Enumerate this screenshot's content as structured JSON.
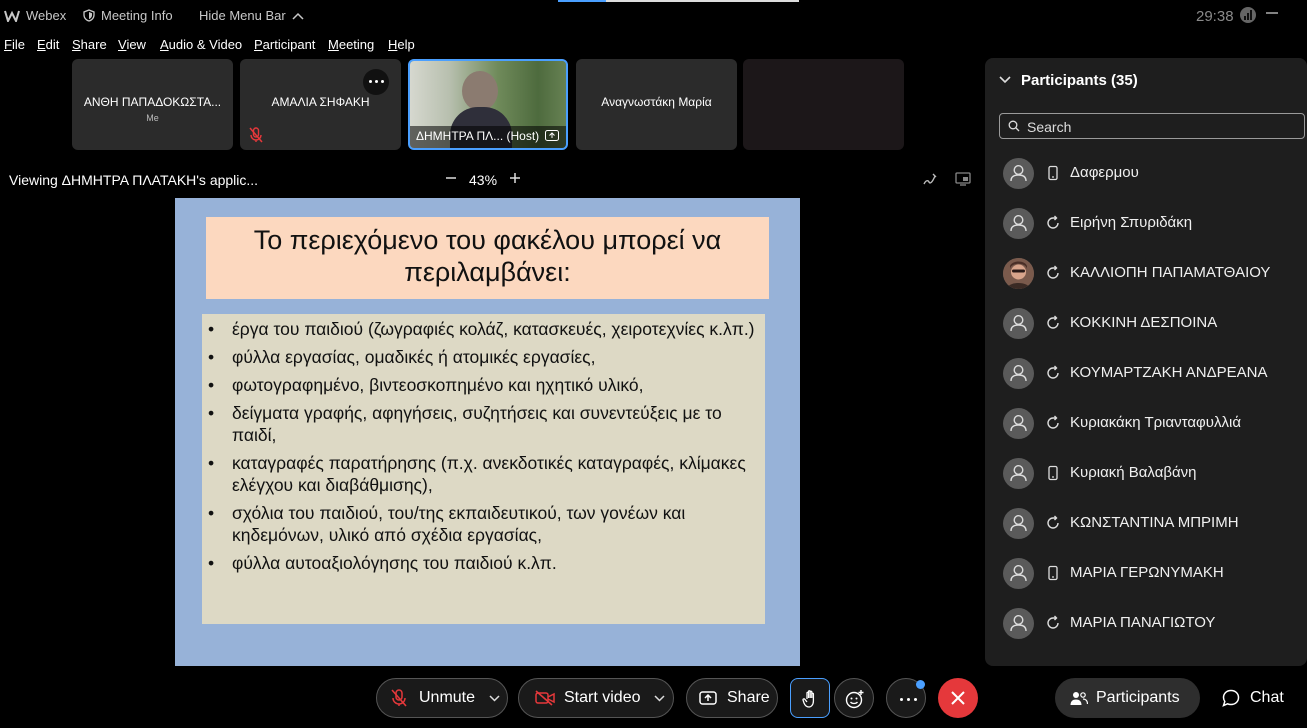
{
  "titlebar": {
    "app": "Webex",
    "meeting_info": "Meeting Info",
    "hide_menu": "Hide Menu Bar",
    "timer": "29:38"
  },
  "menu": [
    "File",
    "Edit",
    "Share",
    "View",
    "Audio & Video",
    "Participant",
    "Meeting",
    "Help"
  ],
  "tiles": [
    {
      "name": "ΑΝΘΗ ΠΑΠΑΔΟΚΩΣΤΑ...",
      "sub": "Me"
    },
    {
      "name": "ΑΜΑΛΙΑ ΣΗΦΑΚΗ"
    },
    {
      "name": "ΔΗΜΗΤΡΑ ΠΛ... (Host)"
    },
    {
      "name": "Αναγνωστάκη Μαρία"
    },
    {
      "name": ""
    }
  ],
  "viewing": {
    "label": "Viewing ΔΗΜΗΤΡΑ ΠΛΑΤΑΚΗ's applic...",
    "zoom": "43%"
  },
  "slide": {
    "title": "Το περιεχόμενο του φακέλου μπορεί να περιλαμβάνει:",
    "bullets": [
      "έργα του παιδιού (ζωγραφιές κολάζ, κατασκευές, χειροτεχνίες κ.λπ.)",
      "φύλλα εργασίας, ομαδικές ή ατομικές εργασίες,",
      "φωτογραφημένο, βιντεοσκοπημένο και ηχητικό υλικό,",
      "δείγματα γραφής, αφηγήσεις, συζητήσεις και συνεντεύξεις με το παιδί,",
      "καταγραφές παρατήρησης (π.χ. ανεκδοτικές καταγραφές, κλίμακες ελέγχου και διαβάθμισης),",
      "σχόλια του παιδιού, του/της εκπαιδευτικού, των γονέων και κηδεμόνων, υλικό από σχέδια εργασίας,",
      "φύλλα αυτοαξιολόγησης του παιδιού κ.λπ."
    ]
  },
  "participants": {
    "header": "Participants (35)",
    "search_placeholder": "Search",
    "list": [
      {
        "name": "Δαφερμου",
        "device": "phone-icon"
      },
      {
        "name": "Ειρήνη Σπυριδάκη",
        "device": "sync-icon"
      },
      {
        "name": "ΚΑΛΛΙΟΠΗ ΠΑΠΑΜΑΤΘΑΙΟΥ",
        "device": "sync-icon",
        "photo": true
      },
      {
        "name": "ΚΟΚΚΙΝΗ ΔΕΣΠΟΙΝΑ",
        "device": "sync-icon"
      },
      {
        "name": "ΚΟΥΜΑΡΤΖΑΚΗ ΑΝΔΡΕΑΝΑ",
        "device": "sync-icon"
      },
      {
        "name": "Κυριακάκη Τριανταφυλλιά",
        "device": "sync-icon"
      },
      {
        "name": "Κυριακή Βαλαβάνη",
        "device": "phone-icon"
      },
      {
        "name": "ΚΩΝΣΤΑΝΤΙΝΑ ΜΠΡΙΜΗ",
        "device": "sync-icon"
      },
      {
        "name": "ΜΑΡΙΑ ΓΕΡΩΝΥΜΑΚΗ",
        "device": "phone-icon"
      },
      {
        "name": "ΜΑΡΙΑ ΠΑΝΑΓΙΩΤΟΥ",
        "device": "sync-icon"
      }
    ]
  },
  "controls": {
    "unmute": "Unmute",
    "start_video": "Start video",
    "share": "Share",
    "participants": "Participants",
    "chat": "Chat"
  },
  "colors": {
    "accent_blue": "#4a9fff",
    "end_red": "#e5383b",
    "slide_bg": "#97b2d8",
    "slide_title_bg": "#fcd8bf",
    "slide_body_bg": "#ddd9c5"
  }
}
